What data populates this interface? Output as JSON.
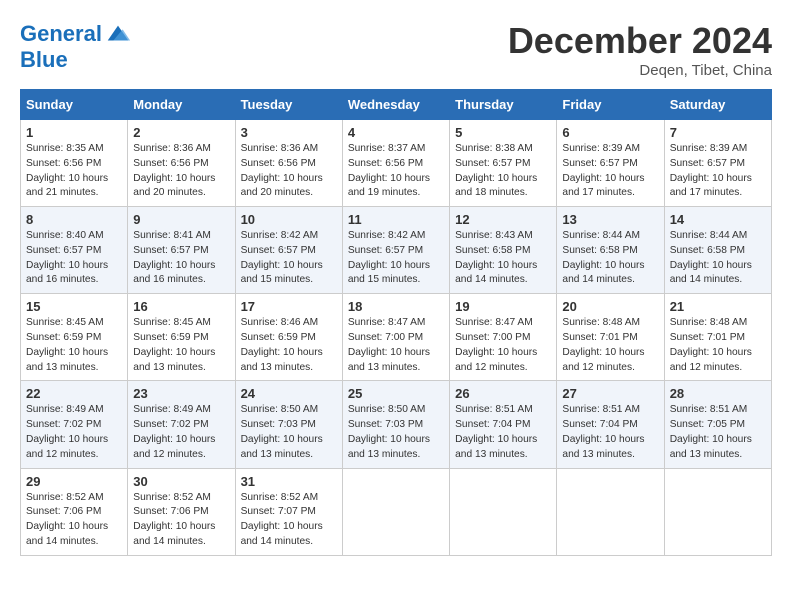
{
  "header": {
    "logo_line1": "General",
    "logo_line2": "Blue",
    "month": "December 2024",
    "location": "Deqen, Tibet, China"
  },
  "weekdays": [
    "Sunday",
    "Monday",
    "Tuesday",
    "Wednesday",
    "Thursday",
    "Friday",
    "Saturday"
  ],
  "weeks": [
    [
      {
        "day": "1",
        "lines": [
          "Sunrise: 8:35 AM",
          "Sunset: 6:56 PM",
          "Daylight: 10 hours",
          "and 21 minutes."
        ]
      },
      {
        "day": "2",
        "lines": [
          "Sunrise: 8:36 AM",
          "Sunset: 6:56 PM",
          "Daylight: 10 hours",
          "and 20 minutes."
        ]
      },
      {
        "day": "3",
        "lines": [
          "Sunrise: 8:36 AM",
          "Sunset: 6:56 PM",
          "Daylight: 10 hours",
          "and 20 minutes."
        ]
      },
      {
        "day": "4",
        "lines": [
          "Sunrise: 8:37 AM",
          "Sunset: 6:56 PM",
          "Daylight: 10 hours",
          "and 19 minutes."
        ]
      },
      {
        "day": "5",
        "lines": [
          "Sunrise: 8:38 AM",
          "Sunset: 6:57 PM",
          "Daylight: 10 hours",
          "and 18 minutes."
        ]
      },
      {
        "day": "6",
        "lines": [
          "Sunrise: 8:39 AM",
          "Sunset: 6:57 PM",
          "Daylight: 10 hours",
          "and 17 minutes."
        ]
      },
      {
        "day": "7",
        "lines": [
          "Sunrise: 8:39 AM",
          "Sunset: 6:57 PM",
          "Daylight: 10 hours",
          "and 17 minutes."
        ]
      }
    ],
    [
      {
        "day": "8",
        "lines": [
          "Sunrise: 8:40 AM",
          "Sunset: 6:57 PM",
          "Daylight: 10 hours",
          "and 16 minutes."
        ]
      },
      {
        "day": "9",
        "lines": [
          "Sunrise: 8:41 AM",
          "Sunset: 6:57 PM",
          "Daylight: 10 hours",
          "and 16 minutes."
        ]
      },
      {
        "day": "10",
        "lines": [
          "Sunrise: 8:42 AM",
          "Sunset: 6:57 PM",
          "Daylight: 10 hours",
          "and 15 minutes."
        ]
      },
      {
        "day": "11",
        "lines": [
          "Sunrise: 8:42 AM",
          "Sunset: 6:57 PM",
          "Daylight: 10 hours",
          "and 15 minutes."
        ]
      },
      {
        "day": "12",
        "lines": [
          "Sunrise: 8:43 AM",
          "Sunset: 6:58 PM",
          "Daylight: 10 hours",
          "and 14 minutes."
        ]
      },
      {
        "day": "13",
        "lines": [
          "Sunrise: 8:44 AM",
          "Sunset: 6:58 PM",
          "Daylight: 10 hours",
          "and 14 minutes."
        ]
      },
      {
        "day": "14",
        "lines": [
          "Sunrise: 8:44 AM",
          "Sunset: 6:58 PM",
          "Daylight: 10 hours",
          "and 14 minutes."
        ]
      }
    ],
    [
      {
        "day": "15",
        "lines": [
          "Sunrise: 8:45 AM",
          "Sunset: 6:59 PM",
          "Daylight: 10 hours",
          "and 13 minutes."
        ]
      },
      {
        "day": "16",
        "lines": [
          "Sunrise: 8:45 AM",
          "Sunset: 6:59 PM",
          "Daylight: 10 hours",
          "and 13 minutes."
        ]
      },
      {
        "day": "17",
        "lines": [
          "Sunrise: 8:46 AM",
          "Sunset: 6:59 PM",
          "Daylight: 10 hours",
          "and 13 minutes."
        ]
      },
      {
        "day": "18",
        "lines": [
          "Sunrise: 8:47 AM",
          "Sunset: 7:00 PM",
          "Daylight: 10 hours",
          "and 13 minutes."
        ]
      },
      {
        "day": "19",
        "lines": [
          "Sunrise: 8:47 AM",
          "Sunset: 7:00 PM",
          "Daylight: 10 hours",
          "and 12 minutes."
        ]
      },
      {
        "day": "20",
        "lines": [
          "Sunrise: 8:48 AM",
          "Sunset: 7:01 PM",
          "Daylight: 10 hours",
          "and 12 minutes."
        ]
      },
      {
        "day": "21",
        "lines": [
          "Sunrise: 8:48 AM",
          "Sunset: 7:01 PM",
          "Daylight: 10 hours",
          "and 12 minutes."
        ]
      }
    ],
    [
      {
        "day": "22",
        "lines": [
          "Sunrise: 8:49 AM",
          "Sunset: 7:02 PM",
          "Daylight: 10 hours",
          "and 12 minutes."
        ]
      },
      {
        "day": "23",
        "lines": [
          "Sunrise: 8:49 AM",
          "Sunset: 7:02 PM",
          "Daylight: 10 hours",
          "and 12 minutes."
        ]
      },
      {
        "day": "24",
        "lines": [
          "Sunrise: 8:50 AM",
          "Sunset: 7:03 PM",
          "Daylight: 10 hours",
          "and 13 minutes."
        ]
      },
      {
        "day": "25",
        "lines": [
          "Sunrise: 8:50 AM",
          "Sunset: 7:03 PM",
          "Daylight: 10 hours",
          "and 13 minutes."
        ]
      },
      {
        "day": "26",
        "lines": [
          "Sunrise: 8:51 AM",
          "Sunset: 7:04 PM",
          "Daylight: 10 hours",
          "and 13 minutes."
        ]
      },
      {
        "day": "27",
        "lines": [
          "Sunrise: 8:51 AM",
          "Sunset: 7:04 PM",
          "Daylight: 10 hours",
          "and 13 minutes."
        ]
      },
      {
        "day": "28",
        "lines": [
          "Sunrise: 8:51 AM",
          "Sunset: 7:05 PM",
          "Daylight: 10 hours",
          "and 13 minutes."
        ]
      }
    ],
    [
      {
        "day": "29",
        "lines": [
          "Sunrise: 8:52 AM",
          "Sunset: 7:06 PM",
          "Daylight: 10 hours",
          "and 14 minutes."
        ]
      },
      {
        "day": "30",
        "lines": [
          "Sunrise: 8:52 AM",
          "Sunset: 7:06 PM",
          "Daylight: 10 hours",
          "and 14 minutes."
        ]
      },
      {
        "day": "31",
        "lines": [
          "Sunrise: 8:52 AM",
          "Sunset: 7:07 PM",
          "Daylight: 10 hours",
          "and 14 minutes."
        ]
      },
      null,
      null,
      null,
      null
    ]
  ]
}
